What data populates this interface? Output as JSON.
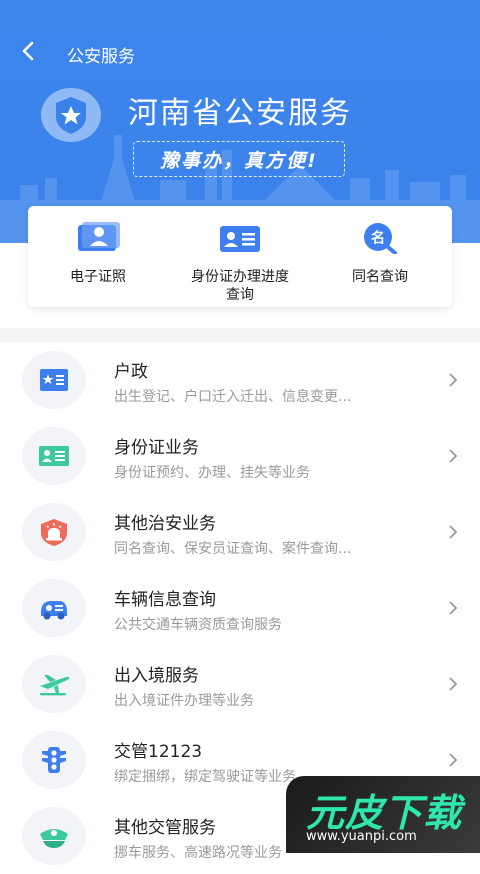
{
  "header": {
    "nav_title": "公安服务",
    "hero_title": "河南省公安服务",
    "slogan": "豫事办，真方便!"
  },
  "quick_actions": [
    {
      "label": "电子证照",
      "icon": "id-card-photo-icon"
    },
    {
      "label": "身份证办理进度\n查询",
      "icon": "id-card-progress-icon"
    },
    {
      "label": "同名查询",
      "icon": "name-search-icon"
    }
  ],
  "services": [
    {
      "title": "户政",
      "subtitle": "出生登记、户口迁入迁出、信息变更...",
      "icon": "household-book-icon"
    },
    {
      "title": "身份证业务",
      "subtitle": "身份证预约、办理、挂失等业务",
      "icon": "id-card-icon"
    },
    {
      "title": "其他治安业务",
      "subtitle": "同名查询、保安员证查询、案件查询...",
      "icon": "police-light-shield-icon"
    },
    {
      "title": "车辆信息查询",
      "subtitle": "公共交通车辆资质查询服务",
      "icon": "car-icon"
    },
    {
      "title": "出入境服务",
      "subtitle": "出入境证件办理等业务",
      "icon": "airplane-icon"
    },
    {
      "title": "交管12123",
      "subtitle": "绑定捆绑，绑定驾驶证等业务",
      "icon": "traffic-light-icon"
    },
    {
      "title": "其他交管服务",
      "subtitle": "挪车服务、高速路况等业务",
      "icon": "police-cap-icon"
    }
  ],
  "watermark": {
    "text": "元皮下载",
    "url": "www.yuanpi.com"
  },
  "colors": {
    "primary": "#3a82ea",
    "icon_blue": "#3d7ff0",
    "icon_green": "#3ec8a0",
    "icon_red": "#ef6a5a",
    "watermark_green": "#2fe7ad"
  }
}
